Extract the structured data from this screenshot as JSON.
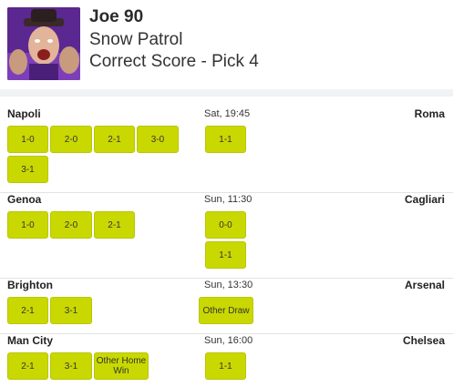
{
  "header": {
    "name": "Joe 90",
    "group": "Snow Patrol",
    "competition": "Correct Score - Pick 4"
  },
  "matches": [
    {
      "home": "Napoli",
      "away": "Roma",
      "kickoff": "Sat, 19:45",
      "home_options": [
        "1-0",
        "2-0",
        "2-1",
        "3-0",
        "3-1"
      ],
      "draw_options": [
        "1-1"
      ]
    },
    {
      "home": "Genoa",
      "away": "Cagliari",
      "kickoff": "Sun, 11:30",
      "home_options": [
        "1-0",
        "2-0",
        "2-1"
      ],
      "draw_options": [
        "0-0",
        "1-1"
      ]
    },
    {
      "home": "Brighton",
      "away": "Arsenal",
      "kickoff": "Sun, 13:30",
      "home_options": [
        "2-1",
        "3-1"
      ],
      "draw_options": [
        "Other Draw"
      ]
    },
    {
      "home": "Man City",
      "away": "Chelsea",
      "kickoff": "Sun, 16:00",
      "home_options": [
        "2-1",
        "3-1",
        "Other Home Win"
      ],
      "draw_options": [
        "1-1"
      ]
    }
  ],
  "colors": {
    "button": "#c9d800",
    "avatar_bg": "#6a2fa0"
  },
  "icons": {
    "avatar": "fan-photo-avatar"
  }
}
